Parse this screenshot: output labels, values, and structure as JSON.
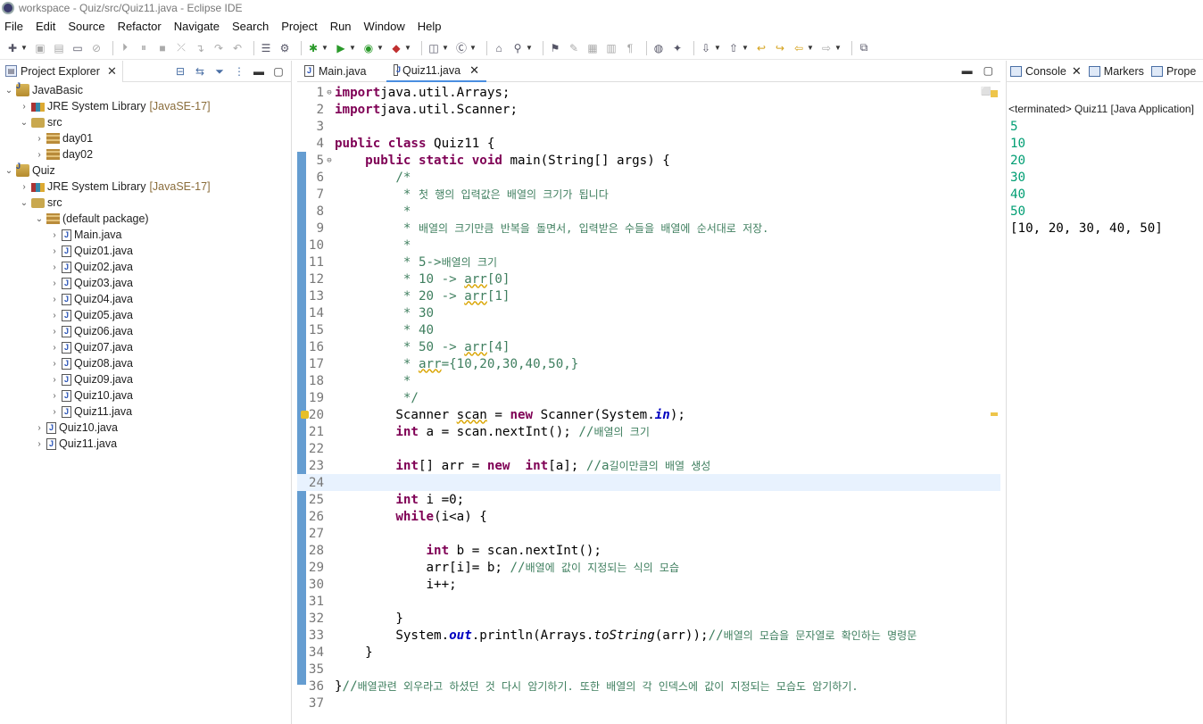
{
  "window": {
    "title": "workspace - Quiz/src/Quiz11.java - Eclipse IDE"
  },
  "menu": [
    "File",
    "Edit",
    "Source",
    "Refactor",
    "Navigate",
    "Search",
    "Project",
    "Run",
    "Window",
    "Help"
  ],
  "project_explorer": {
    "tab_label": "Project Explorer",
    "tree": [
      {
        "label": "JavaBasic",
        "depth": 0,
        "icon": "project",
        "expanded": true
      },
      {
        "label": "JRE System Library",
        "decoration": "[JavaSE-17]",
        "depth": 1,
        "icon": "library",
        "expanded": false
      },
      {
        "label": "src",
        "depth": 1,
        "icon": "source-folder",
        "expanded": true
      },
      {
        "label": "day01",
        "depth": 2,
        "icon": "package",
        "expanded": false
      },
      {
        "label": "day02",
        "depth": 2,
        "icon": "package",
        "expanded": false
      },
      {
        "label": "Quiz",
        "depth": 0,
        "icon": "project",
        "expanded": true
      },
      {
        "label": "JRE System Library",
        "decoration": "[JavaSE-17]",
        "depth": 1,
        "icon": "library",
        "expanded": false
      },
      {
        "label": "src",
        "depth": 1,
        "icon": "source-folder",
        "expanded": true
      },
      {
        "label": "(default package)",
        "depth": 2,
        "icon": "package",
        "expanded": true
      },
      {
        "label": "Main.java",
        "depth": 3,
        "icon": "java-file",
        "expanded": false
      },
      {
        "label": "Quiz01.java",
        "depth": 3,
        "icon": "java-file",
        "expanded": false
      },
      {
        "label": "Quiz02.java",
        "depth": 3,
        "icon": "java-file",
        "expanded": false
      },
      {
        "label": "Quiz03.java",
        "depth": 3,
        "icon": "java-file",
        "expanded": false
      },
      {
        "label": "Quiz04.java",
        "depth": 3,
        "icon": "java-file",
        "expanded": false
      },
      {
        "label": "Quiz05.java",
        "depth": 3,
        "icon": "java-file",
        "expanded": false
      },
      {
        "label": "Quiz06.java",
        "depth": 3,
        "icon": "java-file",
        "expanded": false
      },
      {
        "label": "Quiz07.java",
        "depth": 3,
        "icon": "java-file",
        "expanded": false
      },
      {
        "label": "Quiz08.java",
        "depth": 3,
        "icon": "java-file",
        "expanded": false
      },
      {
        "label": "Quiz09.java",
        "depth": 3,
        "icon": "java-file",
        "expanded": false
      },
      {
        "label": "Quiz10.java",
        "depth": 3,
        "icon": "java-file",
        "expanded": false
      },
      {
        "label": "Quiz11.java",
        "depth": 3,
        "icon": "java-file",
        "expanded": false
      },
      {
        "label": "Quiz10.java",
        "depth": 2,
        "icon": "java-file",
        "expanded": false
      },
      {
        "label": "Quiz11.java",
        "depth": 2,
        "icon": "java-file",
        "expanded": false
      }
    ]
  },
  "editor": {
    "tabs": [
      {
        "label": "Main.java",
        "active": false
      },
      {
        "label": "Quiz11.java",
        "active": true
      }
    ],
    "lines": [
      {
        "n": "1",
        "fold": "⊖",
        "parts": [
          [
            "kw",
            "import"
          ],
          [
            "",
            "java.util.Arrays;"
          ]
        ]
      },
      {
        "n": "2",
        "parts": [
          [
            "kw",
            "import"
          ],
          [
            "",
            "java.util.Scanner;"
          ]
        ]
      },
      {
        "n": "3",
        "parts": []
      },
      {
        "n": "4",
        "parts": [
          [
            "kw",
            "public"
          ],
          [
            "",
            ""
          ],
          [
            "kw",
            "class"
          ],
          [
            "",
            " Quiz11 {"
          ]
        ]
      },
      {
        "n": "5",
        "fold": "⊖",
        "parts": [
          [
            "",
            "    "
          ],
          [
            "kw",
            "public"
          ],
          [
            "",
            ""
          ],
          [
            "kw",
            "static"
          ],
          [
            "",
            ""
          ],
          [
            "kw",
            "void"
          ],
          [
            "",
            " main(String[] args) {"
          ]
        ]
      },
      {
        "n": "6",
        "parts": [
          [
            "jd",
            "        /*"
          ]
        ]
      },
      {
        "n": "7",
        "parts": [
          [
            "jd",
            "         * "
          ],
          [
            "cm",
            "첫 행의 입력값은 배열의 크기가 됩니다"
          ]
        ]
      },
      {
        "n": "8",
        "parts": [
          [
            "jd",
            "         *"
          ]
        ]
      },
      {
        "n": "9",
        "parts": [
          [
            "jd",
            "         * "
          ],
          [
            "cm",
            "배열의 크기만큼 반복을 돌면서, 입력받은 수들을 배열에 순서대로 저장."
          ]
        ]
      },
      {
        "n": "10",
        "parts": [
          [
            "jd",
            "         *"
          ]
        ]
      },
      {
        "n": "11",
        "parts": [
          [
            "jd",
            "         * 5->"
          ],
          [
            "cm",
            "배열의 크기"
          ]
        ]
      },
      {
        "n": "12",
        "parts": [
          [
            "jd",
            "         * 10 -> "
          ],
          [
            "jdw",
            "arr"
          ],
          [
            "jd",
            "[0]"
          ]
        ]
      },
      {
        "n": "13",
        "parts": [
          [
            "jd",
            "         * 20 -> "
          ],
          [
            "jdw",
            "arr"
          ],
          [
            "jd",
            "[1]"
          ]
        ]
      },
      {
        "n": "14",
        "parts": [
          [
            "jd",
            "         * 30"
          ]
        ]
      },
      {
        "n": "15",
        "parts": [
          [
            "jd",
            "         * 40"
          ]
        ]
      },
      {
        "n": "16",
        "parts": [
          [
            "jd",
            "         * 50 -> "
          ],
          [
            "jdw",
            "arr"
          ],
          [
            "jd",
            "[4]"
          ]
        ]
      },
      {
        "n": "17",
        "parts": [
          [
            "jd",
            "         * "
          ],
          [
            "jdw",
            "arr"
          ],
          [
            "jd",
            "={10,20,30,40,50,}"
          ]
        ]
      },
      {
        "n": "18",
        "parts": [
          [
            "jd",
            "         *"
          ]
        ]
      },
      {
        "n": "19",
        "parts": [
          [
            "jd",
            "         */"
          ]
        ]
      },
      {
        "n": "20",
        "warn": true,
        "parts": [
          [
            "",
            "        Scanner "
          ],
          [
            "w",
            "scan"
          ],
          [
            "",
            " = "
          ],
          [
            "kw",
            "new"
          ],
          [
            "",
            " Scanner(System."
          ],
          [
            "fld",
            "in"
          ],
          [
            "",
            ");"
          ]
        ]
      },
      {
        "n": "21",
        "parts": [
          [
            "",
            "        "
          ],
          [
            "kw",
            "int"
          ],
          [
            "",
            " a = scan.nextInt(); "
          ],
          [
            "jd",
            "//"
          ],
          [
            "cm",
            "배열의 크기"
          ]
        ]
      },
      {
        "n": "22",
        "parts": []
      },
      {
        "n": "23",
        "parts": [
          [
            "",
            "        "
          ],
          [
            "kw",
            "int"
          ],
          [
            "",
            "[] arr = "
          ],
          [
            "kw",
            "new"
          ],
          [
            "",
            ""
          ],
          [
            "kw",
            " int"
          ],
          [
            "",
            "[a]; "
          ],
          [
            "jd",
            "//a"
          ],
          [
            "cm",
            "길이만큼의 배열 생성"
          ]
        ]
      },
      {
        "n": "24",
        "hl": true,
        "parts": []
      },
      {
        "n": "25",
        "parts": [
          [
            "",
            "        "
          ],
          [
            "kw",
            "int"
          ],
          [
            "",
            " i =0;"
          ]
        ]
      },
      {
        "n": "26",
        "parts": [
          [
            "",
            "        "
          ],
          [
            "kw",
            "while"
          ],
          [
            "",
            "(i<a) {"
          ]
        ]
      },
      {
        "n": "27",
        "parts": []
      },
      {
        "n": "28",
        "parts": [
          [
            "",
            "            "
          ],
          [
            "kw",
            "int"
          ],
          [
            "",
            " b = scan.nextInt();"
          ]
        ]
      },
      {
        "n": "29",
        "parts": [
          [
            "",
            "            arr[i]= b; "
          ],
          [
            "jd",
            "//"
          ],
          [
            "cm",
            "배열에 값이 지정되는 식의 모습"
          ]
        ]
      },
      {
        "n": "30",
        "parts": [
          [
            "",
            "            i++;"
          ]
        ]
      },
      {
        "n": "31",
        "parts": []
      },
      {
        "n": "32",
        "parts": [
          [
            "",
            "        }"
          ]
        ]
      },
      {
        "n": "33",
        "parts": [
          [
            "",
            "        System."
          ],
          [
            "fld",
            "out"
          ],
          [
            "",
            ".println(Arrays."
          ],
          [
            "st",
            "toString"
          ],
          [
            "",
            "(arr));"
          ],
          [
            "jd",
            "//"
          ],
          [
            "cm",
            "배열의 모습을 문자열로 확인하는 명령문"
          ]
        ]
      },
      {
        "n": "34",
        "parts": [
          [
            "",
            "    }"
          ]
        ]
      },
      {
        "n": "35",
        "parts": []
      },
      {
        "n": "36",
        "parts": [
          [
            "",
            "}"
          ],
          [
            "jd",
            "//"
          ],
          [
            "cm",
            "배열관련 외우라고 하셨던 것 다시 암기하기. 또한 배열의 각 인덱스에 값이 지정되는 모습도 암기하기."
          ]
        ]
      },
      {
        "n": "37",
        "parts": []
      }
    ]
  },
  "console": {
    "tabs": [
      "Console",
      "Markers",
      "Prope"
    ],
    "status": "<terminated> Quiz11 [Java Application]",
    "input_lines": [
      "5",
      "10",
      "20",
      "30",
      "40",
      "50"
    ],
    "output_lines": [
      "[10, 20, 30, 40, 50]"
    ]
  },
  "colors": {
    "keyword": "#7f0055",
    "comment": "#3f7f5f",
    "field": "#0000c0",
    "console_input": "#009e73",
    "current_line": "#e8f2fe"
  }
}
